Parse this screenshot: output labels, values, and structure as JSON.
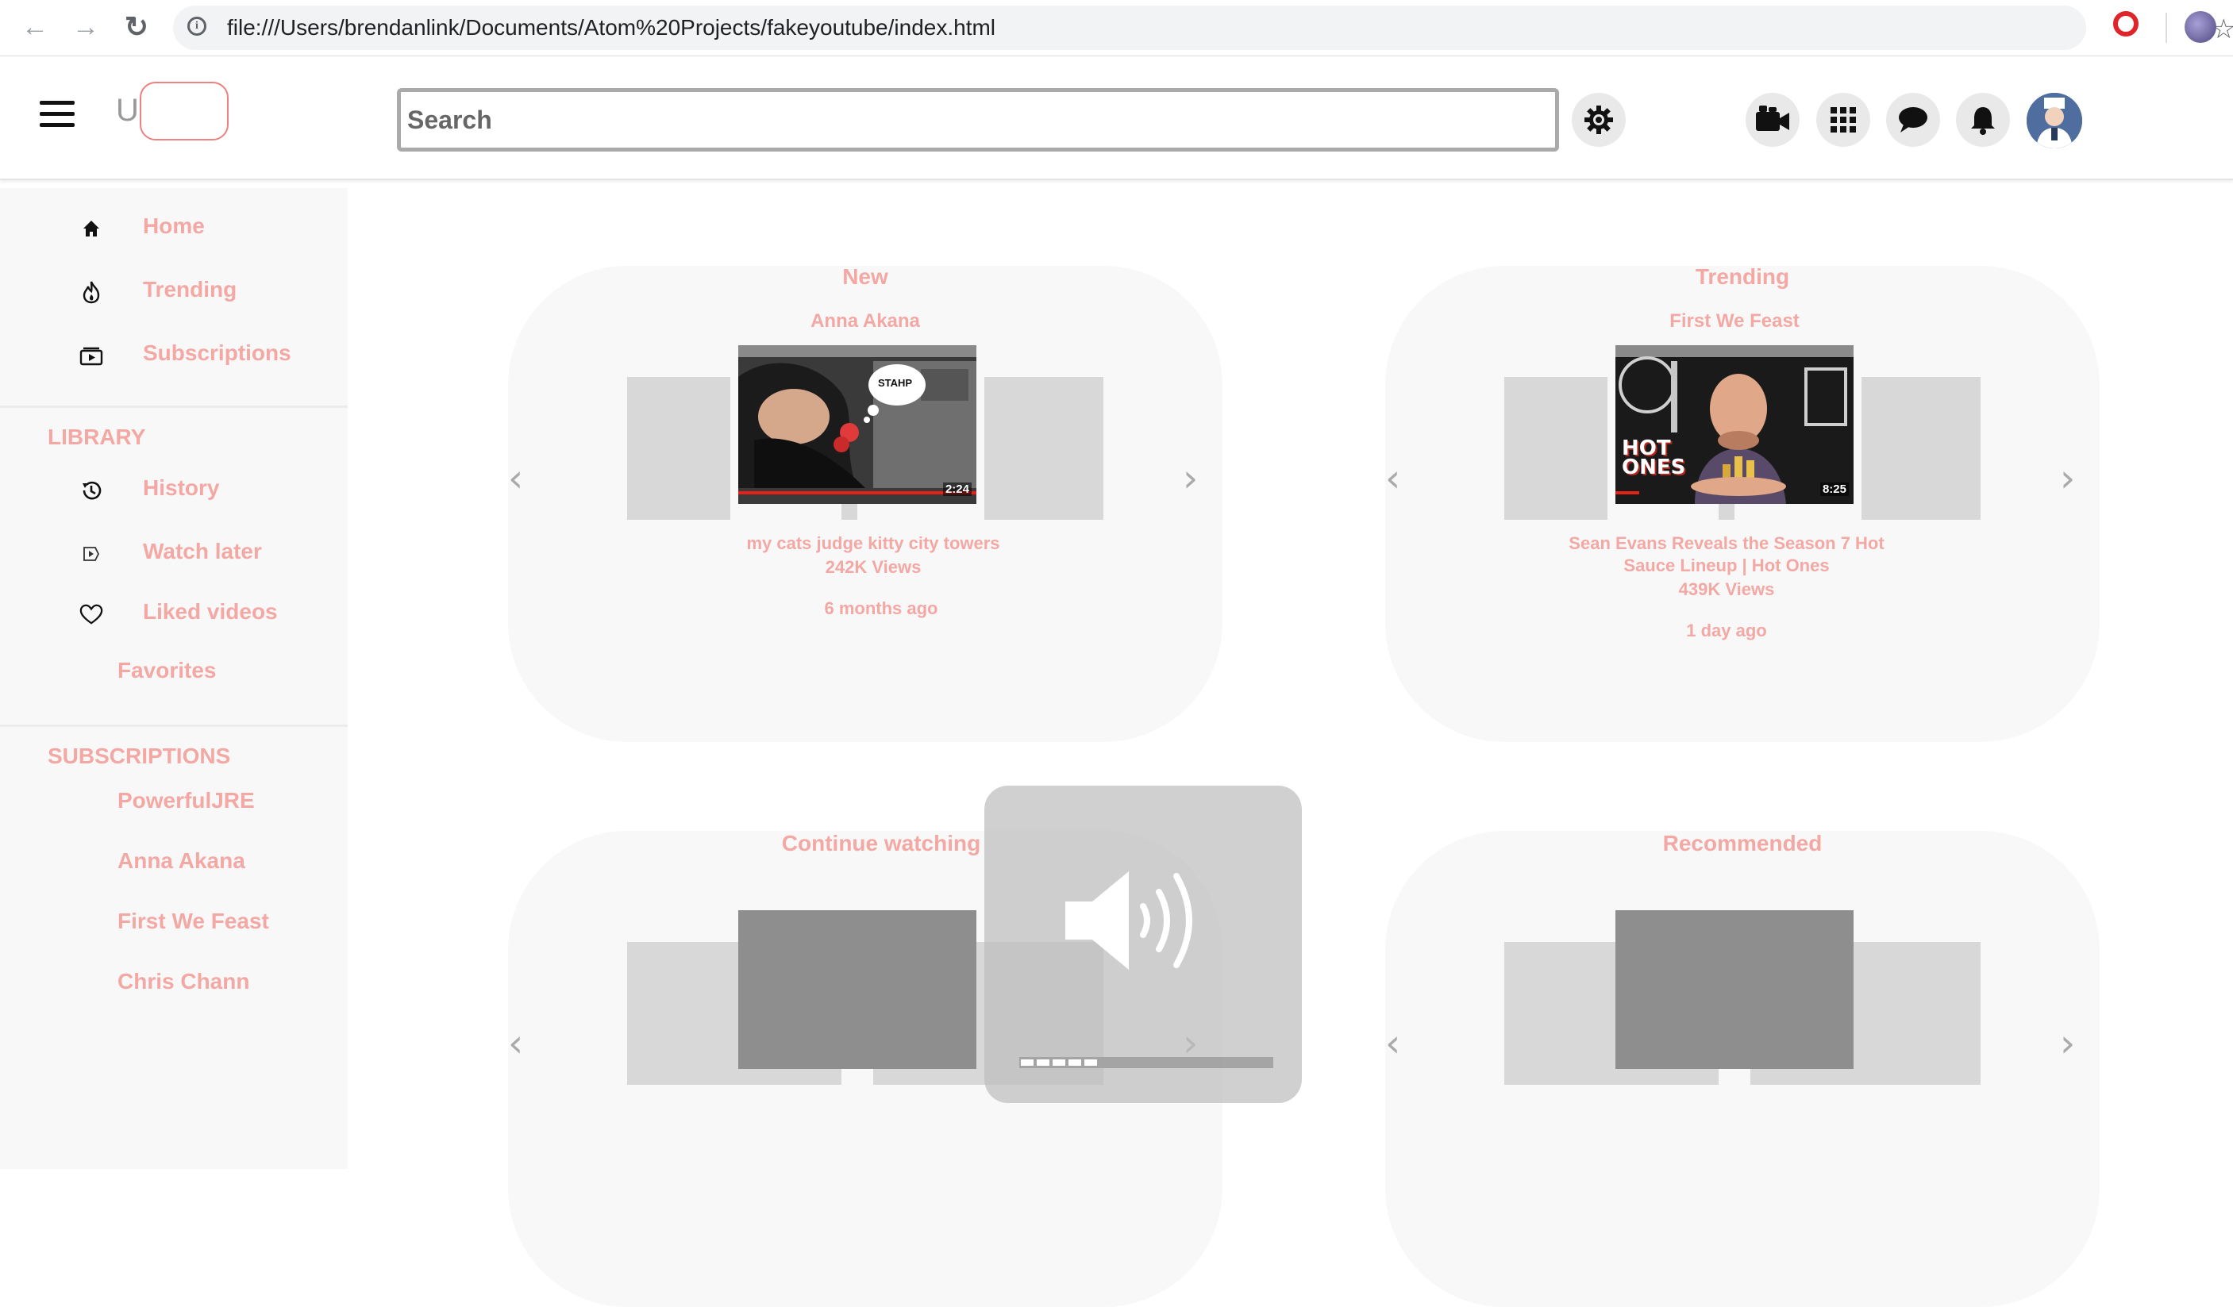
{
  "browser": {
    "url": "file:///Users/brendanlink/Documents/Atom%20Projects/fakeyoutube/index.html",
    "back_icon": "arrow-left-icon",
    "forward_icon": "arrow-right-icon",
    "reload_icon": "reload-icon"
  },
  "header": {
    "logo_letter": "U",
    "search_placeholder": "Search"
  },
  "sidebar": {
    "main_items": [
      {
        "label": "Home",
        "icon": "home-icon"
      },
      {
        "label": "Trending",
        "icon": "flame-icon"
      },
      {
        "label": "Subscriptions",
        "icon": "subscriptions-icon"
      }
    ],
    "library_title": "LIBRARY",
    "library_items": [
      {
        "label": "History",
        "icon": "history-icon"
      },
      {
        "label": "Watch later",
        "icon": "watch-later-icon"
      },
      {
        "label": "Liked videos",
        "icon": "heart-icon"
      }
    ],
    "favorites_label": "Favorites",
    "subscriptions_title": "SUBSCRIPTIONS",
    "subscriptions": [
      "PowerfulJRE",
      "Anna Akana",
      "First We Feast",
      "Chris Chann"
    ]
  },
  "cards": [
    {
      "title": "New",
      "channel": "Anna Akana",
      "video_title": "my cats judge kitty city towers",
      "views": "242K Views",
      "age": "6 months ago",
      "duration": "2:24",
      "thumb_caption": "STAHP",
      "progress": 1.0
    },
    {
      "title": "Trending",
      "channel": "First We Feast",
      "video_title": "Sean Evans Reveals the Season 7 Hot Sauce Lineup | Hot Ones",
      "views": "439K Views",
      "age": "1 day ago",
      "duration": "8:25",
      "thumb_caption": "HOT ONES",
      "progress": 0.1
    },
    {
      "title": "Continue watching"
    },
    {
      "title": "Recommended"
    }
  ],
  "volume": {
    "level": 0.3,
    "icon": "speaker-icon"
  },
  "colors": {
    "accent": "#f3a8a4",
    "card_bg": "#f8f8f8"
  }
}
